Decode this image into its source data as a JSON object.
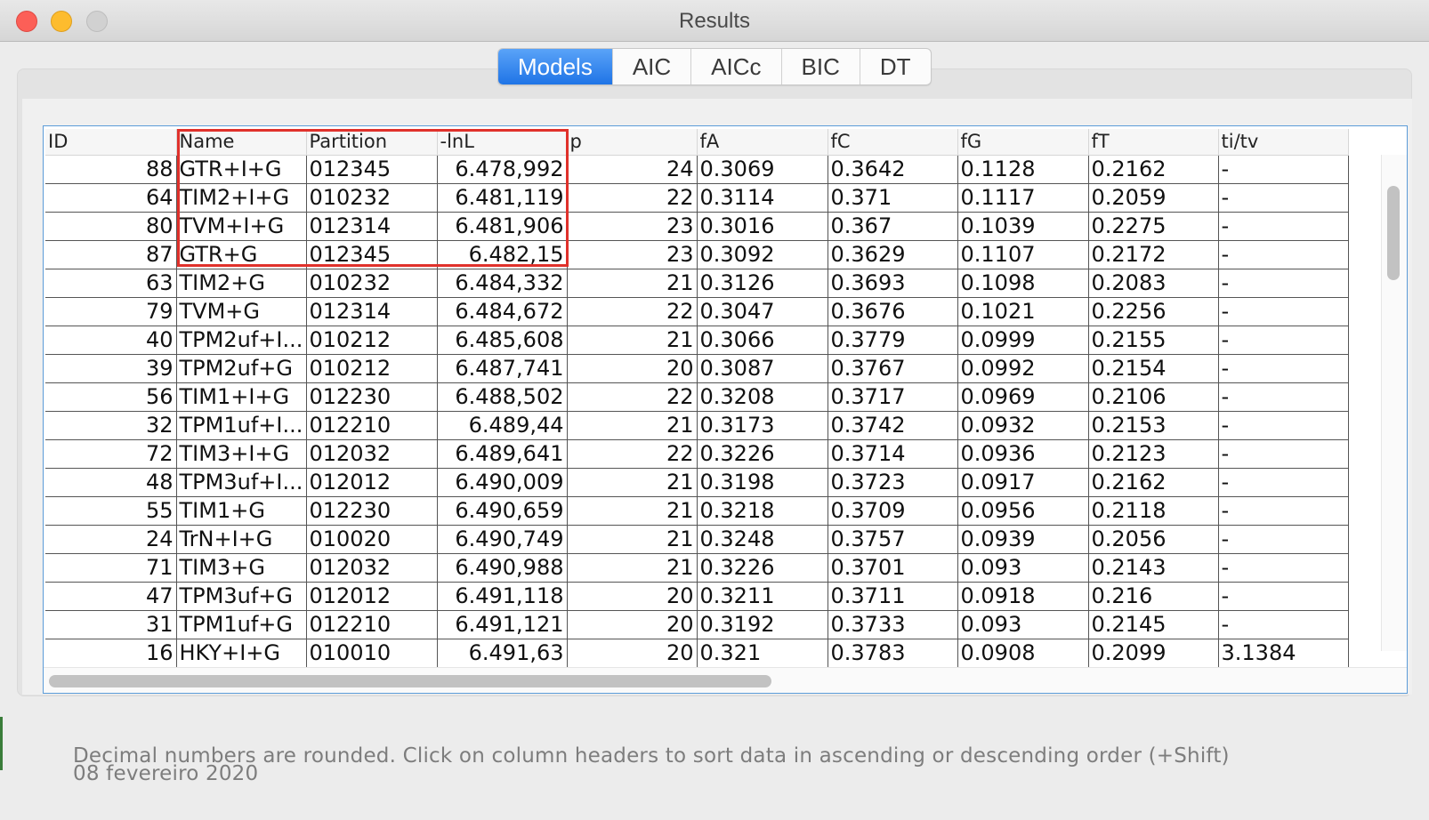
{
  "window": {
    "title": "Results"
  },
  "tabs": [
    {
      "label": "Models",
      "active": true
    },
    {
      "label": "AIC",
      "active": false
    },
    {
      "label": "AICc",
      "active": false
    },
    {
      "label": "BIC",
      "active": false
    },
    {
      "label": "DT",
      "active": false
    }
  ],
  "table": {
    "columns": [
      "ID",
      "Name",
      "Partition",
      "-lnL",
      "p",
      "fA",
      "fC",
      "fG",
      "fT",
      "ti/tv"
    ],
    "rows": [
      [
        "88",
        "GTR+I+G",
        "012345",
        "6.478,992",
        "24",
        "0.3069",
        "0.3642",
        "0.1128",
        "0.2162",
        "-"
      ],
      [
        "64",
        "TIM2+I+G",
        "010232",
        "6.481,119",
        "22",
        "0.3114",
        "0.371",
        "0.1117",
        "0.2059",
        "-"
      ],
      [
        "80",
        "TVM+I+G",
        "012314",
        "6.481,906",
        "23",
        "0.3016",
        "0.367",
        "0.1039",
        "0.2275",
        "-"
      ],
      [
        "87",
        "GTR+G",
        "012345",
        "6.482,15",
        "23",
        "0.3092",
        "0.3629",
        "0.1107",
        "0.2172",
        "-"
      ],
      [
        "63",
        "TIM2+G",
        "010232",
        "6.484,332",
        "21",
        "0.3126",
        "0.3693",
        "0.1098",
        "0.2083",
        "-"
      ],
      [
        "79",
        "TVM+G",
        "012314",
        "6.484,672",
        "22",
        "0.3047",
        "0.3676",
        "0.1021",
        "0.2256",
        "-"
      ],
      [
        "40",
        "TPM2uf+I...",
        "010212",
        "6.485,608",
        "21",
        "0.3066",
        "0.3779",
        "0.0999",
        "0.2155",
        "-"
      ],
      [
        "39",
        "TPM2uf+G",
        "010212",
        "6.487,741",
        "20",
        "0.3087",
        "0.3767",
        "0.0992",
        "0.2154",
        "-"
      ],
      [
        "56",
        "TIM1+I+G",
        "012230",
        "6.488,502",
        "22",
        "0.3208",
        "0.3717",
        "0.0969",
        "0.2106",
        "-"
      ],
      [
        "32",
        "TPM1uf+I...",
        "012210",
        "6.489,44",
        "21",
        "0.3173",
        "0.3742",
        "0.0932",
        "0.2153",
        "-"
      ],
      [
        "72",
        "TIM3+I+G",
        "012032",
        "6.489,641",
        "22",
        "0.3226",
        "0.3714",
        "0.0936",
        "0.2123",
        "-"
      ],
      [
        "48",
        "TPM3uf+I...",
        "012012",
        "6.490,009",
        "21",
        "0.3198",
        "0.3723",
        "0.0917",
        "0.2162",
        "-"
      ],
      [
        "55",
        "TIM1+G",
        "012230",
        "6.490,659",
        "21",
        "0.3218",
        "0.3709",
        "0.0956",
        "0.2118",
        "-"
      ],
      [
        "24",
        "TrN+I+G",
        "010020",
        "6.490,749",
        "21",
        "0.3248",
        "0.3757",
        "0.0939",
        "0.2056",
        "-"
      ],
      [
        "71",
        "TIM3+G",
        "012032",
        "6.490,988",
        "21",
        "0.3226",
        "0.3701",
        "0.093",
        "0.2143",
        "-"
      ],
      [
        "47",
        "TPM3uf+G",
        "012012",
        "6.491,118",
        "20",
        "0.3211",
        "0.3711",
        "0.0918",
        "0.216",
        "-"
      ],
      [
        "31",
        "TPM1uf+G",
        "012210",
        "6.491,121",
        "20",
        "0.3192",
        "0.3733",
        "0.093",
        "0.2145",
        "-"
      ],
      [
        "16",
        "HKY+I+G",
        "010010",
        "6.491,63",
        "20",
        "0.321",
        "0.3783",
        "0.0908",
        "0.2099",
        "3.1384"
      ]
    ]
  },
  "footer": {
    "note": "Decimal numbers are rounded. Click on column headers to sort data in ascending or descending order (+Shift)",
    "date": "08 fevereiro 2020"
  },
  "colors": {
    "accent": "#1f74e6",
    "highlight": "#e0312b"
  }
}
